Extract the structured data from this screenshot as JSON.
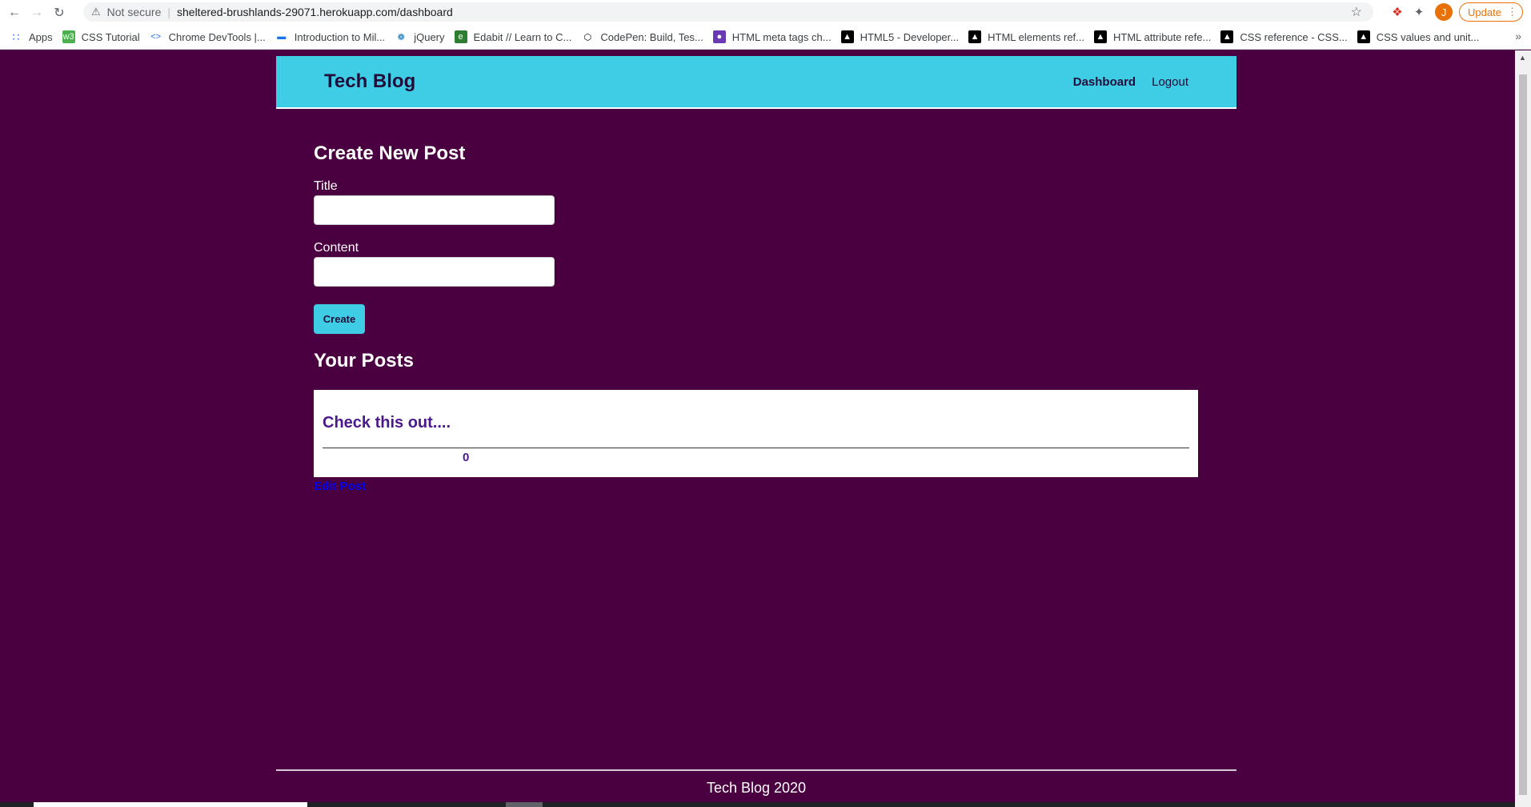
{
  "browser": {
    "security_label": "Not secure",
    "url": "sheltered-brushlands-29071.herokuapp.com/dashboard",
    "avatar_letter": "J",
    "update_label": "Update"
  },
  "bookmarks": [
    {
      "label": "Apps",
      "icon": "apps-grid-icon",
      "color": "#1a73e8"
    },
    {
      "label": "CSS Tutorial",
      "icon": "w3schools-icon",
      "color": "#4caf50"
    },
    {
      "label": "Chrome DevTools |...",
      "icon": "devtools-icon",
      "color": "#1a73e8"
    },
    {
      "label": "Introduction to Mil...",
      "icon": "doc-icon",
      "color": "#1a73e8"
    },
    {
      "label": "jQuery",
      "icon": "jquery-icon",
      "color": "#0769ad"
    },
    {
      "label": "Edabit // Learn to C...",
      "icon": "edabit-icon",
      "color": "#2e7d32"
    },
    {
      "label": "CodePen: Build, Tes...",
      "icon": "codepen-icon",
      "color": "#000000"
    },
    {
      "label": "HTML meta tags ch...",
      "icon": "bookmark-icon",
      "color": "#6a3ab2"
    },
    {
      "label": "HTML5 - Developer...",
      "icon": "mdn-icon",
      "color": "#000000"
    },
    {
      "label": "HTML elements ref...",
      "icon": "mdn-icon",
      "color": "#000000"
    },
    {
      "label": "HTML attribute refe...",
      "icon": "mdn-icon",
      "color": "#000000"
    },
    {
      "label": "CSS reference - CSS...",
      "icon": "mdn-icon",
      "color": "#000000"
    },
    {
      "label": "CSS values and unit...",
      "icon": "mdn-icon",
      "color": "#000000"
    }
  ],
  "header": {
    "title": "Tech Blog",
    "nav": {
      "dashboard": "Dashboard",
      "logout": "Logout"
    }
  },
  "create_form": {
    "heading": "Create New Post",
    "title_label": "Title",
    "title_value": "",
    "content_label": "Content",
    "content_value": "",
    "submit_label": "Create"
  },
  "posts_section": {
    "heading": "Your Posts",
    "posts": [
      {
        "title": "Check this out....",
        "count": "0",
        "edit_label": "Edit Post"
      }
    ]
  },
  "footer": {
    "text": "Tech Blog 2020"
  },
  "colors": {
    "background": "#4a0040",
    "accent": "#3ecde5",
    "header_text": "#220d3a",
    "post_title": "#4a1a8a",
    "link": "#0000ee"
  }
}
